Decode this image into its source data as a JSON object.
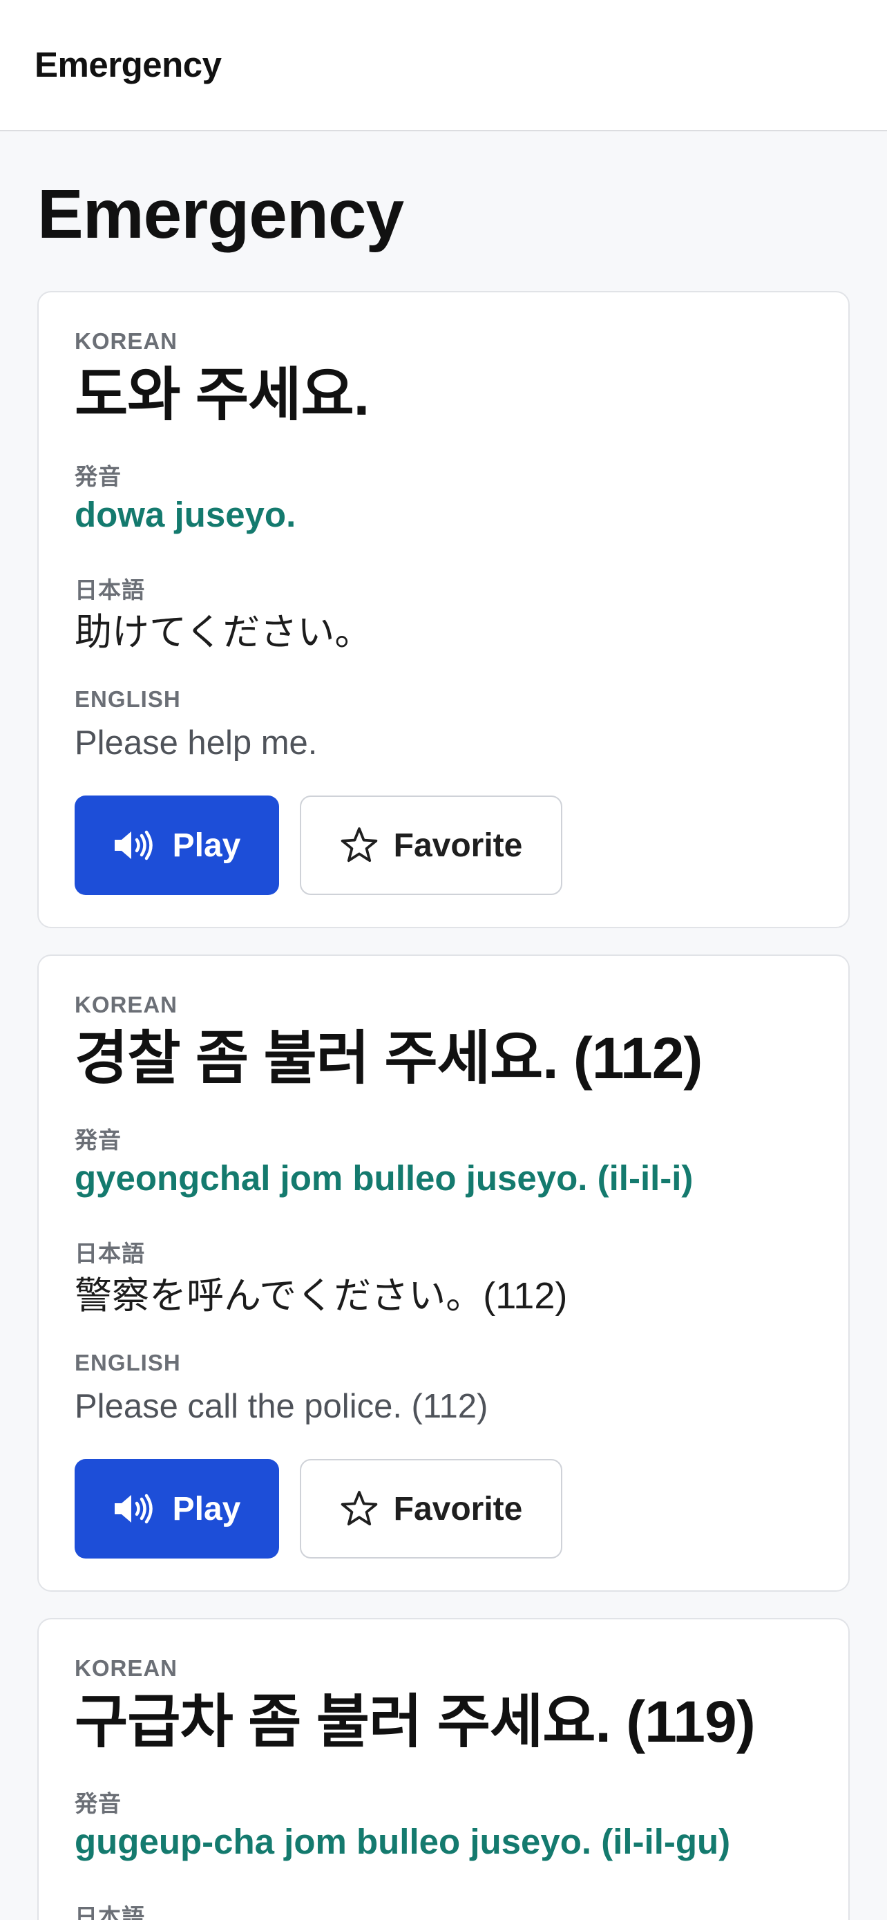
{
  "header": {
    "title": "Emergency"
  },
  "page": {
    "title": "Emergency"
  },
  "labels": {
    "korean": "KOREAN",
    "pronunciation": "発音",
    "japanese": "日本語",
    "english": "ENGLISH"
  },
  "buttons": {
    "play": "Play",
    "favorite": "Favorite"
  },
  "icons": {
    "play": "speaker-icon",
    "favorite": "star-outline-icon"
  },
  "colors": {
    "accent": "#1d4ed8",
    "romanization": "#147a6e"
  },
  "phrases": [
    {
      "korean": "도와 주세요.",
      "romanization": "dowa juseyo.",
      "japanese": "助けてください。",
      "english": "Please help me."
    },
    {
      "korean": "경찰 좀 불러 주세요. (112)",
      "romanization": "gyeongchal jom bulleo juseyo. (il-il-i)",
      "japanese": "警察を呼んでください。(112)",
      "english": "Please call the police. (112)"
    },
    {
      "korean": "구급차 좀 불러 주세요. (119)",
      "romanization": "gugeup-cha jom bulleo juseyo. (il-il-gu)",
      "japanese": "",
      "english": ""
    }
  ]
}
